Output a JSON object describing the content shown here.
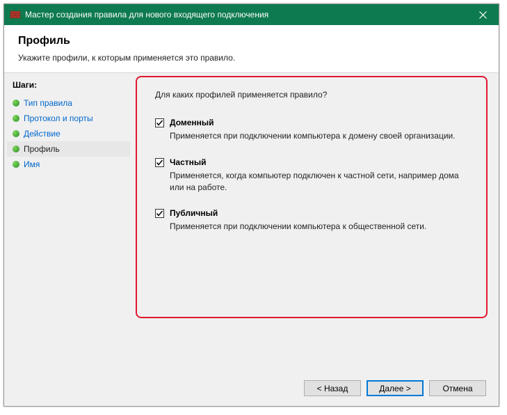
{
  "titlebar": {
    "title": "Мастер создания правила для нового входящего подключения"
  },
  "header": {
    "title": "Профиль",
    "subtitle": "Укажите профили, к которым применяется это правило."
  },
  "sidebar": {
    "steps_label": "Шаги:",
    "items": [
      {
        "label": "Тип правила"
      },
      {
        "label": "Протокол и порты"
      },
      {
        "label": "Действие"
      },
      {
        "label": "Профиль"
      },
      {
        "label": "Имя"
      }
    ]
  },
  "main": {
    "question": "Для каких профилей применяется правило?",
    "options": [
      {
        "label": "Доменный",
        "desc": "Применяется при подключении компьютера к домену своей организации."
      },
      {
        "label": "Частный",
        "desc": "Применяется, когда компьютер подключен к частной сети, например дома или на работе."
      },
      {
        "label": "Публичный",
        "desc": "Применяется при подключении компьютера к общественной сети."
      }
    ]
  },
  "footer": {
    "back": "< Назад",
    "next": "Далее >",
    "cancel": "Отмена"
  }
}
